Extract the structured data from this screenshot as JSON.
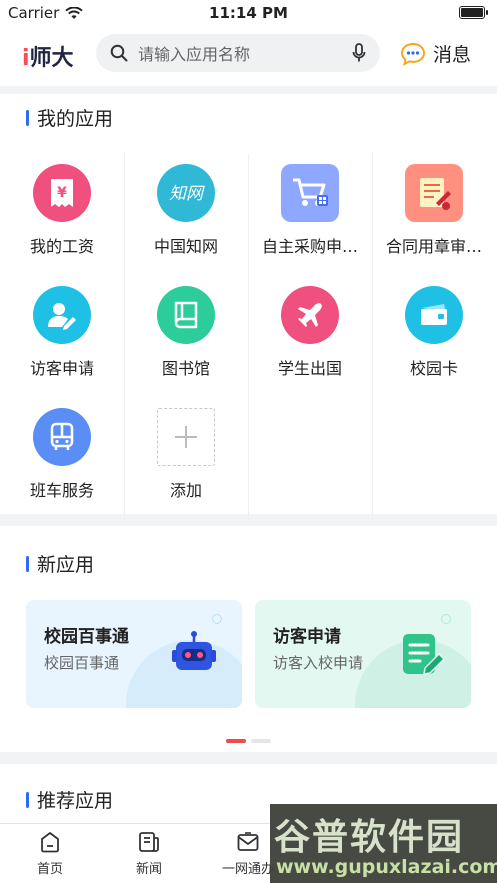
{
  "status_bar": {
    "carrier": "Carrier",
    "time": "11:14 PM"
  },
  "header": {
    "logo_prefix": "i",
    "logo_text": "师大",
    "search_placeholder": "请输入应用名称",
    "messages_label": "消息"
  },
  "my_apps": {
    "title": "我的应用",
    "items": [
      {
        "label": "我的工资",
        "icon": "salary-icon",
        "color": "#f0507e"
      },
      {
        "label": "中国知网",
        "icon": "cnki-icon",
        "color": "#2fb9d6"
      },
      {
        "label": "自主采购申…",
        "icon": "shopping-cart-icon",
        "color": "#8fa8ff"
      },
      {
        "label": "合同用章审…",
        "icon": "contract-seal-icon",
        "color": "#ff8f7f"
      },
      {
        "label": "访客申请",
        "icon": "visitor-icon",
        "color": "#1ec0e6"
      },
      {
        "label": "图书馆",
        "icon": "book-icon",
        "color": "#2ccd9a"
      },
      {
        "label": "学生出国",
        "icon": "airplane-icon",
        "color": "#f0507e"
      },
      {
        "label": "校园卡",
        "icon": "card-icon",
        "color": "#1ec0e6"
      },
      {
        "label": "班车服务",
        "icon": "bus-icon",
        "color": "#5a8ef5"
      },
      {
        "label": "添加",
        "icon": "add-icon",
        "color": "#cccccc"
      }
    ]
  },
  "new_apps": {
    "title": "新应用",
    "cards": [
      {
        "title": "校园百事通",
        "subtitle": "校园百事通",
        "icon": "robot-icon",
        "bg": "#e8f5ff"
      },
      {
        "title": "访客申请",
        "subtitle": "访客入校申请",
        "icon": "form-edit-icon",
        "bg": "#e3f8f1"
      }
    ]
  },
  "recommended": {
    "title": "推荐应用"
  },
  "tabs": [
    {
      "label": "首页",
      "icon": "home-icon"
    },
    {
      "label": "新闻",
      "icon": "news-icon"
    },
    {
      "label": "一网通办",
      "icon": "envelope-icon"
    }
  ],
  "watermark": {
    "cn": "谷普软件园",
    "url": "www.gupuxlazai.com"
  }
}
